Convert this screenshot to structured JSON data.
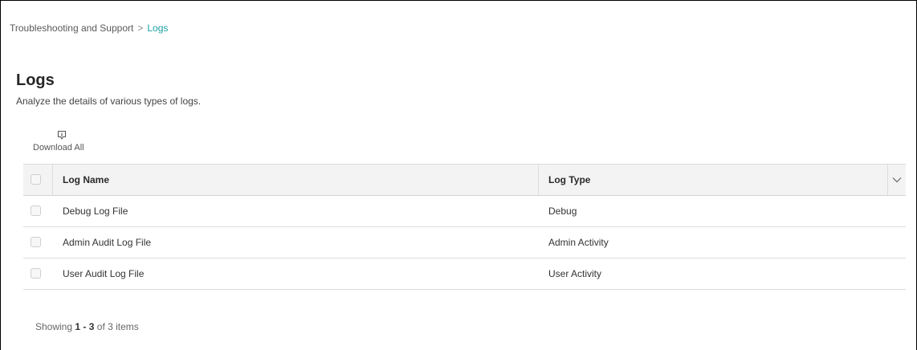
{
  "breadcrumb": {
    "parent": "Troubleshooting and Support",
    "separator": ">",
    "current": "Logs"
  },
  "page": {
    "title": "Logs",
    "description": "Analyze the details of various types of logs."
  },
  "toolbar": {
    "download_all_label": "Download All",
    "download_icon": "download-icon"
  },
  "table": {
    "columns": [
      "Log Name",
      "Log Type"
    ],
    "menu_icon": "chevron-down-icon",
    "rows": [
      {
        "name": "Debug Log File",
        "type": "Debug"
      },
      {
        "name": "Admin Audit Log File",
        "type": "Admin Activity"
      },
      {
        "name": "User Audit Log File",
        "type": "User Activity"
      }
    ]
  },
  "pagination": {
    "prefix": "Showing",
    "range_start": "1",
    "range_sep": "-",
    "range_end": "3",
    "of_text": "of 3 items"
  },
  "colors": {
    "accent": "#1aa1a3",
    "header_bg": "#f3f3f3",
    "border": "#dcdcdc"
  }
}
